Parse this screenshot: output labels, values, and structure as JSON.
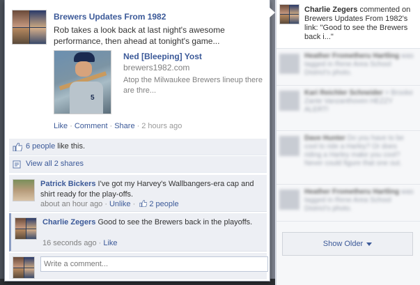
{
  "post": {
    "page_name": "Brewers Updates From 1982",
    "text": "Rob takes a look back at last night's awesome performance, then ahead at tonight's game...",
    "link": {
      "title": "Ned [Bleeping] Yost",
      "domain": "brewers1982.com",
      "description": "Atop the Milwaukee Brewers lineup there are thre..."
    },
    "actions": {
      "like": "Like",
      "comment": "Comment",
      "share": "Share",
      "timestamp": "2 hours ago"
    }
  },
  "ufi": {
    "likes_link": "6 people",
    "likes_suffix": " like this.",
    "shares": "View all 2 shares"
  },
  "comments": [
    {
      "author": "Patrick Bickers",
      "text": " I've got my Harvey's Wallbangers-era cap and shirt ready for the play-offs.",
      "time": "about an hour ago",
      "action": "Unlike",
      "likes": "2 people"
    },
    {
      "author": "Charlie Zegers",
      "text": " Good to see the Brewers back in the playoffs.",
      "time": "16 seconds ago",
      "action": "Like"
    }
  ],
  "composer": {
    "placeholder": "Write a comment..."
  },
  "ticker": {
    "top": {
      "actor": "Charlie Zegers",
      "text": " commented on Brewers Updates From 1982's link: \"Good to see the Brewers back i...\""
    },
    "items": [
      {
        "name": "Heather Frometheru Hartling",
        "text": " was tagged in Rene Area School District's photo."
      },
      {
        "name": "Kari Reichler Schneider",
        "text": " > Brooke Zante Vanzanthoven HEZZY ALERT!"
      },
      {
        "name": "Dave Hunter",
        "text": " Do you have to be cool to ride a Harley? Or does riding a Harley make you cool? Never could figure that one out."
      },
      {
        "name": "Heather Frometheru Hartling",
        "text": " was tagged in Rene Area School District's photo."
      }
    ],
    "show_older": "Show Older"
  },
  "colors": {
    "link": "#3b5998",
    "ufi_bg": "#edeff4",
    "meta_gray": "#808080"
  }
}
